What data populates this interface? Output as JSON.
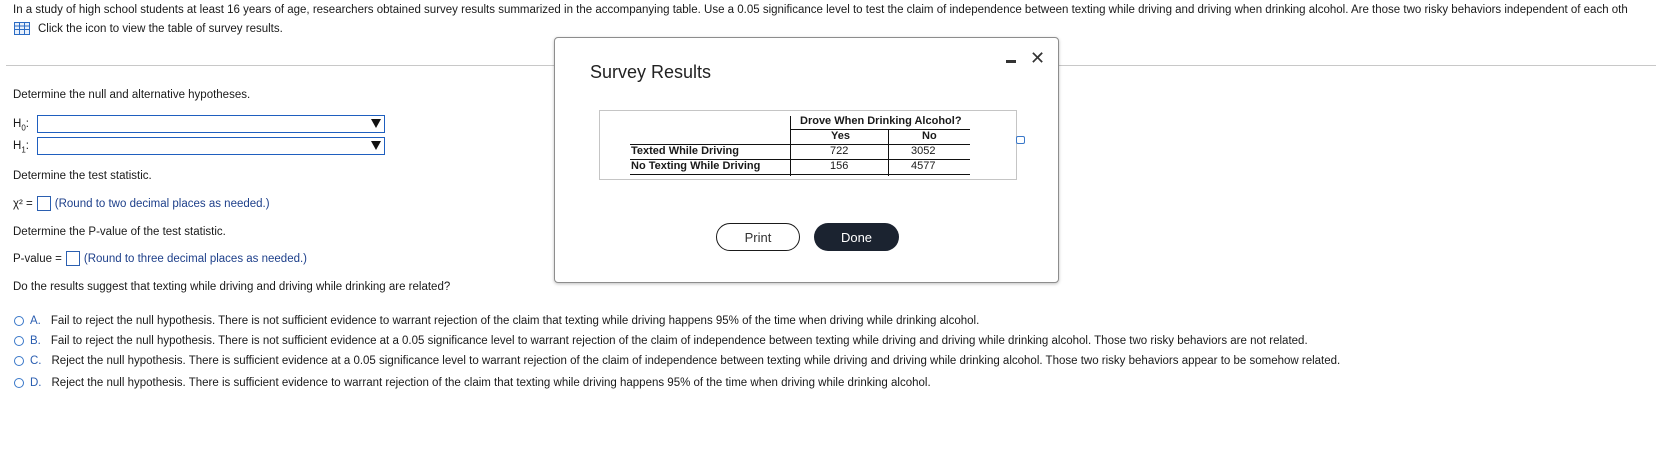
{
  "intro_text": "In a study of high school students at least 16 years of age, researchers obtained survey results summarized in the accompanying table. Use a 0.05 significance level to test the claim of independence between texting while driving and driving when drinking alcohol. Are those two risky behaviors independent of each oth",
  "click_text": "Click the icon to view the table of survey results.",
  "hypotheses": {
    "prompt": "Determine the null and alternative hypotheses.",
    "h0_label": "H",
    "h0_sub": "0",
    "h1_label": "H",
    "h1_sub": "1",
    "colon": ":"
  },
  "test_stat": {
    "prompt": "Determine the test statistic.",
    "symbol": "χ² =",
    "hint": "(Round to two decimal places as needed.)"
  },
  "p_value": {
    "prompt": "Determine the P-value of the test statistic.",
    "label": "P-value =",
    "hint": "(Round to three decimal places as needed.)"
  },
  "conclusion_prompt": "Do the results suggest that texting while driving and driving while drinking are related?",
  "options": [
    {
      "letter": "A.",
      "text": "Fail to reject the null hypothesis. There is not sufficient evidence to warrant rejection of the claim that texting while driving happens 95% of the time when driving while drinking alcohol."
    },
    {
      "letter": "B.",
      "text": "Fail to reject the null hypothesis. There is not sufficient evidence at a 0.05 significance level to warrant rejection of the claim of independence between texting while driving and driving while drinking alcohol. Those two risky behaviors are not related."
    },
    {
      "letter": "C.",
      "text": "Reject the null hypothesis. There is sufficient evidence at a 0.05 significance level to warrant rejection of the claim of independence between texting while driving and driving while drinking alcohol. Those two risky behaviors appear to be somehow related."
    },
    {
      "letter": "D.",
      "text": "Reject the null hypothesis. There is sufficient evidence to warrant rejection of the claim that texting while driving happens 95% of the time when driving while drinking alcohol."
    }
  ],
  "dialog": {
    "title": "Survey Results",
    "min_icon": "minimize-icon",
    "close_icon": "close-icon",
    "close_glyph": "✕",
    "table": {
      "header": "Drove When Drinking Alcohol?",
      "col_yes": "Yes",
      "col_no": "No",
      "rows": [
        {
          "label": "Texted While Driving",
          "yes": "722",
          "no": "3052"
        },
        {
          "label": "No Texting While Driving",
          "yes": "156",
          "no": "4577"
        }
      ]
    },
    "print_label": "Print",
    "done_label": "Done"
  },
  "colors": {
    "accent_blue": "#1f5fbf",
    "done_button": "#1b2330"
  }
}
